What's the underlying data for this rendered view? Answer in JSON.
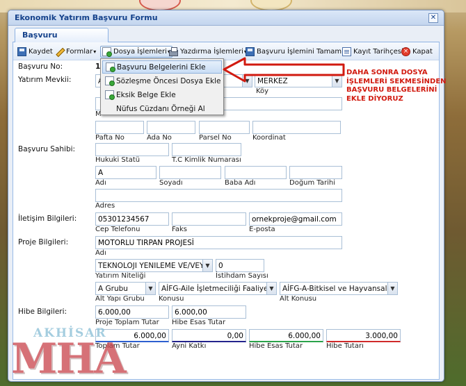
{
  "window": {
    "title": "Ekonomik Yatırım Başvuru Formu",
    "close": "✕",
    "tab": "Başvuru"
  },
  "toolbar": {
    "kaydet": "Kaydet",
    "formlar": "Formlar",
    "dosya": "Dosya İşlemleri",
    "yazdirma": "Yazdırma İşlemleri",
    "tamamla": "Başvuru İşlemini Tamamla",
    "tarihce": "Kayıt Tarihçesi",
    "kapat": "Kapat",
    "caret": "▾"
  },
  "menu": {
    "items": [
      "Başvuru Belgelerini Ekle",
      "Sözleşme Öncesi Dosya Ekle",
      "Eksik Belge Ekle",
      "Nüfus Cüzdanı Örneği Al"
    ]
  },
  "annotation": "DAHA SONRA DOSYA İŞLEMLERİ SEKMESİNDEN BAŞVURU BELGELERİNİ EKLE DİYORUZ",
  "form": {
    "basvuru_no": {
      "label": "Başvuru No:",
      "value": "1"
    },
    "yatirim_mevkii": {
      "label": "Yatırım Mevkii:",
      "il": "A",
      "mahalle": "MERKEZ",
      "koy_label": "Köy",
      "m_label": "M"
    },
    "parsel": {
      "pafta": "Pafta No",
      "ada": "Ada No",
      "parsel": "Parsel No",
      "koordinat": "Koordinat"
    },
    "basvuru_sahibi": {
      "label": "Başvuru Sahibi:",
      "hukuki": "Hukuki Statü",
      "tc": "T.C Kimlik Numarası",
      "adi": "Adı",
      "soyadi": "Soyadı",
      "baba": "Baba Adı",
      "dogum": "Doğum Tarihi",
      "adres": "Adres",
      "adi_val": "A"
    },
    "iletisim": {
      "label": "İletişim Bilgileri:",
      "cep": "05301234567",
      "cep_label": "Cep Telefonu",
      "faks_label": "Faks",
      "eposta": "ornekproje@gmail.com",
      "eposta_label": "E-posta"
    },
    "proje": {
      "label": "Proje Bilgileri:",
      "adi": "MOTORLU TIRPAN PROJESİ",
      "adi_label": "Adı",
      "niteligi": "TEKNOLOJI YENILEME VE/VEYA",
      "niteligi_label": "Yatırım Niteliği",
      "istihdam": "0",
      "istihdam_label": "İstihdam Sayısı",
      "alt_yapi": "A Grubu",
      "alt_yapi_label": "Alt Yapı Grubu",
      "konu": "AİFG-Aile İşletmeciliği Faaliyetle",
      "konu_label": "Konusu",
      "alt_konu": "AİFG-A-Bitkisel ve Hayvansal Ü",
      "alt_konu_label": "Alt Konusu"
    },
    "hibe": {
      "label": "Hibe Bilgileri:",
      "toplam": "6.000,00",
      "toplam_label": "Proje Toplam Tutar",
      "esas": "6.000,00",
      "esas_label": "Hibe Esas Tutar",
      "t2": "6.000,00",
      "t2_label": "Toplam Tutar",
      "ayni": "0,00",
      "ayni_label": "Ayni Katkı",
      "esas2": "6.000,00",
      "esas2_label": "Hibe Esas Tutar",
      "hibe_tutar": "3.000,00",
      "hibe_tutar_label": "Hibe Tutarı"
    }
  },
  "logo": {
    "top": "AKHİSAR",
    "main": "MHA"
  }
}
